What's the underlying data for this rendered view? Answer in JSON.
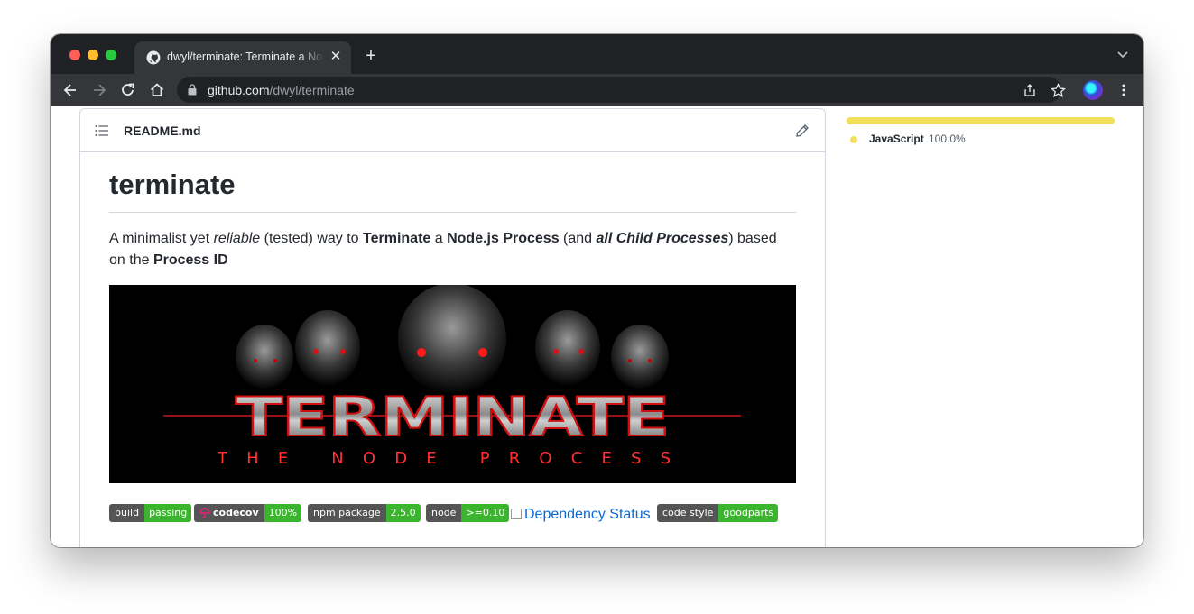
{
  "browser": {
    "tab_title": "dwyl/terminate: Terminate a Node.js Process",
    "url_host": "github.com",
    "url_path": "/dwyl/terminate"
  },
  "readme": {
    "file_name": "README.md",
    "heading": "terminate",
    "description": {
      "t1": "A minimalist yet ",
      "t2": "reliable",
      "t3": " (tested) way to ",
      "t4": "Terminate",
      "t5": " a ",
      "t6": "Node.js Process",
      "t7": " (and ",
      "t8": "all Child Processes",
      "t9": ") based on the ",
      "t10": "Process ID"
    },
    "banner": {
      "title": "TERMINATE",
      "subtitle": "THE NODE PROCESS"
    },
    "badges": [
      {
        "label": "build",
        "value": "passing"
      },
      {
        "label": "codecov",
        "value": "100%"
      },
      {
        "label": "npm package",
        "value": "2.5.0"
      },
      {
        "label": "node",
        "value": ">=0.10"
      },
      {
        "label": "code style",
        "value": "goodparts"
      }
    ],
    "dependency_link": "Dependency Status"
  },
  "sidebar": {
    "language": "JavaScript",
    "percent": "100.0%",
    "language_color": "#f1e05a"
  }
}
